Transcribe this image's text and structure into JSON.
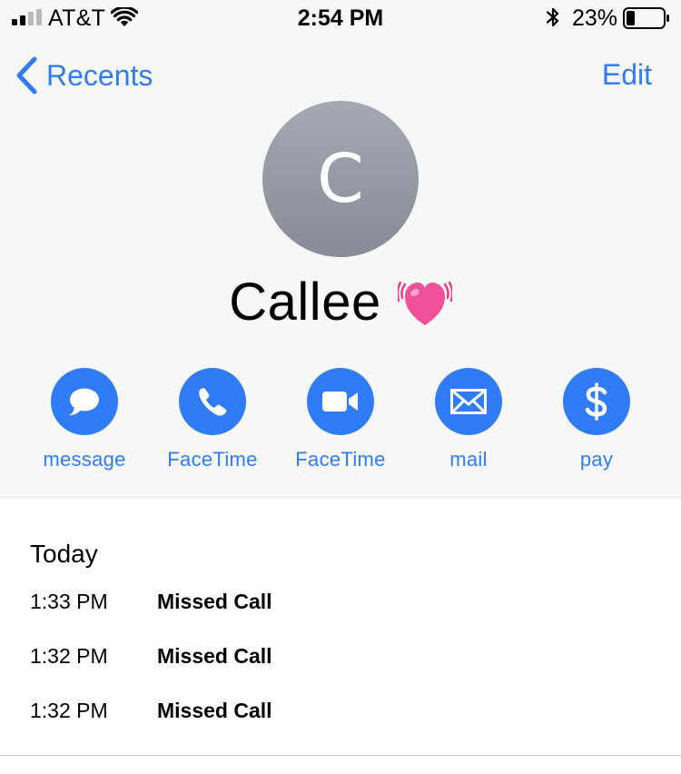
{
  "status_bar": {
    "carrier": "AT&T",
    "time": "2:54 PM",
    "battery_percent": "23%",
    "signal_bars": 2,
    "signal_bars_total": 4,
    "battery_level": 0.23,
    "icons": [
      "signal-icon",
      "wifi-icon",
      "bluetooth-icon",
      "battery-icon"
    ]
  },
  "nav": {
    "back_label": "Recents",
    "edit_label": "Edit"
  },
  "contact": {
    "initial": "C",
    "name": "Callee",
    "emoji_icon": "beating-heart-icon"
  },
  "actions": [
    {
      "label": "message",
      "icon": "message-bubble-icon"
    },
    {
      "label": "FaceTime",
      "icon": "phone-icon"
    },
    {
      "label": "FaceTime",
      "icon": "video-camera-icon"
    },
    {
      "label": "mail",
      "icon": "envelope-icon"
    },
    {
      "label": "pay",
      "icon": "dollar-icon"
    }
  ],
  "history": {
    "title": "Today",
    "calls": [
      {
        "time": "1:33 PM",
        "status": "Missed Call"
      },
      {
        "time": "1:32 PM",
        "status": "Missed Call"
      },
      {
        "time": "1:32 PM",
        "status": "Missed Call"
      }
    ]
  },
  "colors": {
    "accent": "#2f7cf6",
    "header_background": "#f7f7f8",
    "avatar": "#9a9ea8",
    "heart": "#f0509a"
  }
}
